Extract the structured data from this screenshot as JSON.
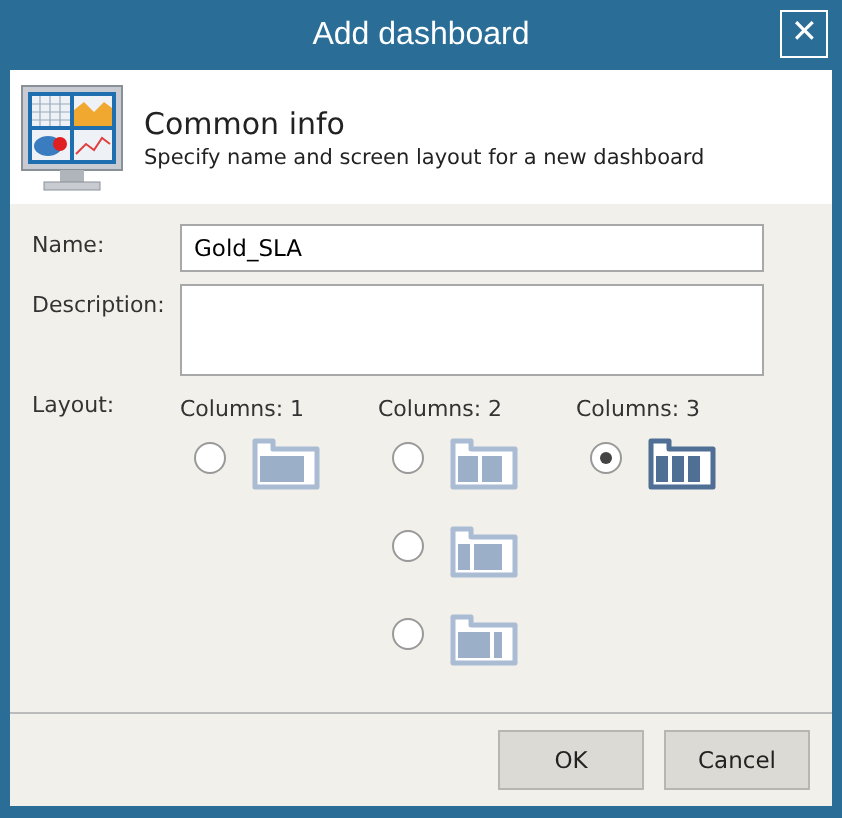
{
  "window": {
    "title": "Add dashboard",
    "close": "✕"
  },
  "header": {
    "title": "Common info",
    "subtitle": "Specify name and screen layout for a new dashboard"
  },
  "form": {
    "name_label": "Name:",
    "name_value": "Gold_SLA",
    "description_label": "Description:",
    "layout_label": "Layout:"
  },
  "layout_groups": [
    {
      "label": "Columns: 1",
      "options": [
        {
          "kind": "single",
          "selected": false
        }
      ]
    },
    {
      "label": "Columns: 2",
      "options": [
        {
          "kind": "equal",
          "selected": false
        },
        {
          "kind": "narrow-wide",
          "selected": false
        },
        {
          "kind": "wide-narrow",
          "selected": false
        }
      ]
    },
    {
      "label": "Columns: 3",
      "options": [
        {
          "kind": "three",
          "selected": true
        }
      ]
    }
  ],
  "buttons": [
    "OK",
    "Cancel"
  ]
}
